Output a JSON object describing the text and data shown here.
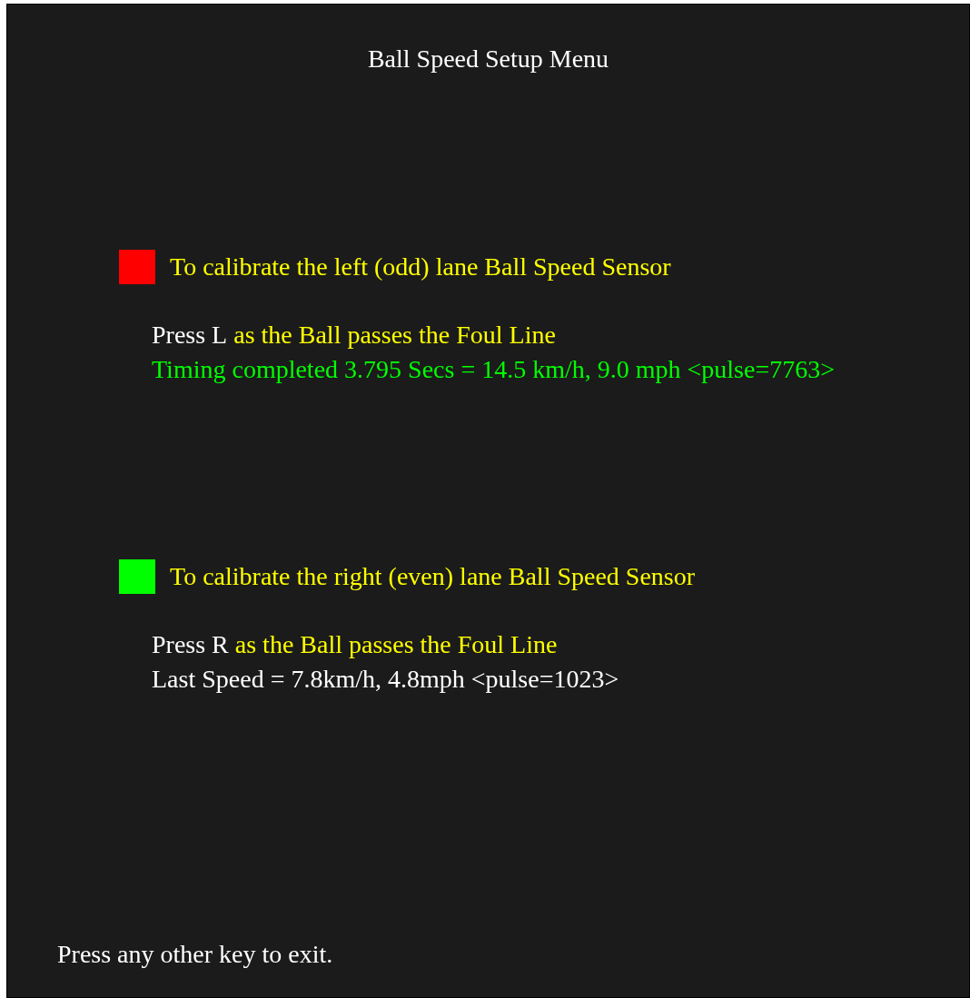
{
  "title": "Ball Speed Setup Menu",
  "sections": [
    {
      "color": "#ff0000",
      "heading": "To calibrate the left (odd) lane Ball Speed Sensor",
      "key_label": "Press L",
      "instruction": "as the Ball passes the Foul Line",
      "status": {
        "kind": "completed",
        "text": "Timing completed 3.795 Secs = 14.5 km/h, 9.0 mph <pulse=7763>"
      }
    },
    {
      "color": "#00ff00",
      "heading": "To calibrate the right (even) lane Ball Speed Sensor",
      "key_label": "Press R",
      "instruction": "as the Ball passes the Foul Line",
      "status": {
        "kind": "last",
        "text": "Last Speed = 7.8km/h, 4.8mph <pulse=1023>"
      }
    }
  ],
  "footer": "Press any other key to exit."
}
